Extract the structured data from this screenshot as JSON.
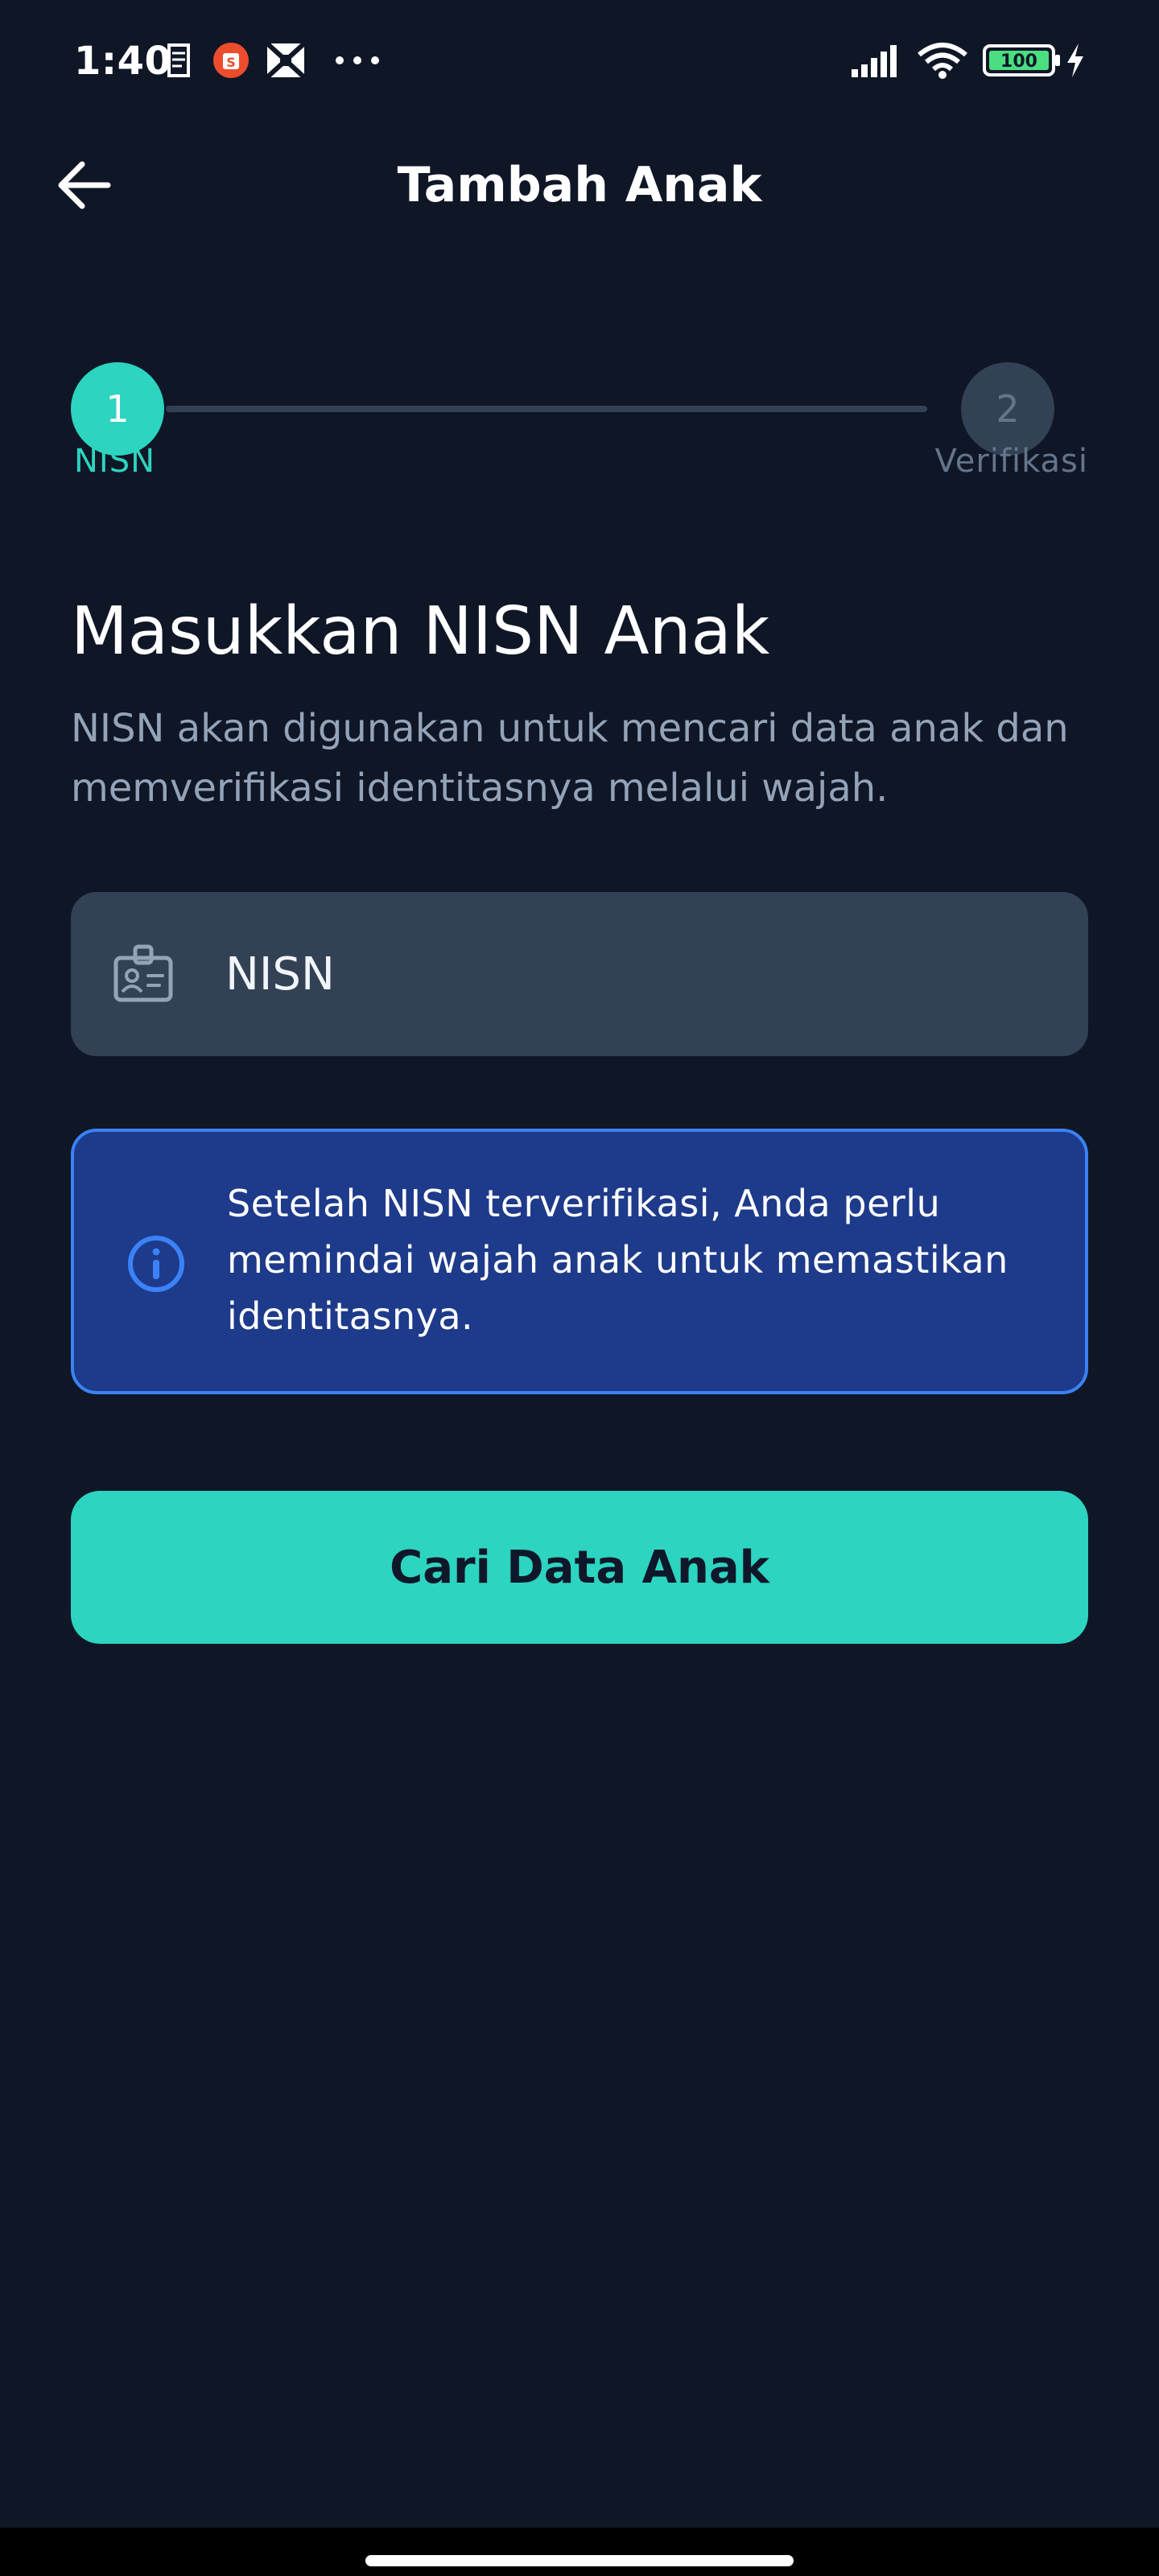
{
  "status_bar": {
    "time": "1:40",
    "battery": "100",
    "icons": [
      "sim-icon",
      "shopee-icon",
      "photo-icon",
      "more-icon",
      "signal-icon",
      "wifi-icon",
      "battery-icon",
      "charging-icon"
    ]
  },
  "header": {
    "title": "Tambah Anak",
    "back_icon": "arrow-left-icon"
  },
  "stepper": {
    "steps": [
      {
        "number": "1",
        "label": "NISN",
        "state": "active"
      },
      {
        "number": "2",
        "label": "Verifikasi",
        "state": "inactive"
      }
    ]
  },
  "content": {
    "title": "Masukkan NISN Anak",
    "subtitle": "NISN akan digunakan untuk mencari data anak dan memverifikasi identitasnya melalui wajah."
  },
  "input": {
    "placeholder": "NISN",
    "value": "",
    "icon": "id-card-icon"
  },
  "info": {
    "icon": "info-icon",
    "text": "Setelah NISN terverifikasi, Anda perlu memindai wajah anak untuk memastikan identitasnya."
  },
  "button": {
    "label": "Cari Data Anak"
  },
  "colors": {
    "background": "#0f1727",
    "accent": "#2dd4bf",
    "input_bg": "#334155",
    "info_bg": "#1e3a8a",
    "info_border": "#3b82f6",
    "muted_text": "#94a3b8"
  }
}
